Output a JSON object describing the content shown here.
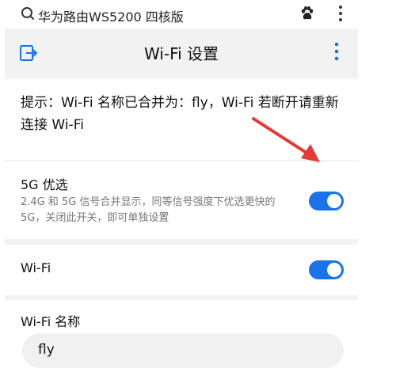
{
  "browser": {
    "search_query": "华为路由WS5200 四核版"
  },
  "appbar": {
    "title": "Wi-Fi 设置"
  },
  "hint": {
    "text": "提示：Wi-Fi 名称已合并为：fly，Wi-Fi 若断开请重新连接 Wi-Fi"
  },
  "fiveg": {
    "title": "5G 优选",
    "description": "2.4G 和 5G 信号合并显示，同等信号强度下优选更快的 5G，关闭此开关，即可单独设置",
    "enabled": true
  },
  "wifi": {
    "label": "Wi-Fi",
    "enabled": true,
    "name_label": "Wi-Fi 名称",
    "name_value": "fly"
  },
  "colors": {
    "accent": "#1a73e8",
    "arrow": "#e53935"
  }
}
